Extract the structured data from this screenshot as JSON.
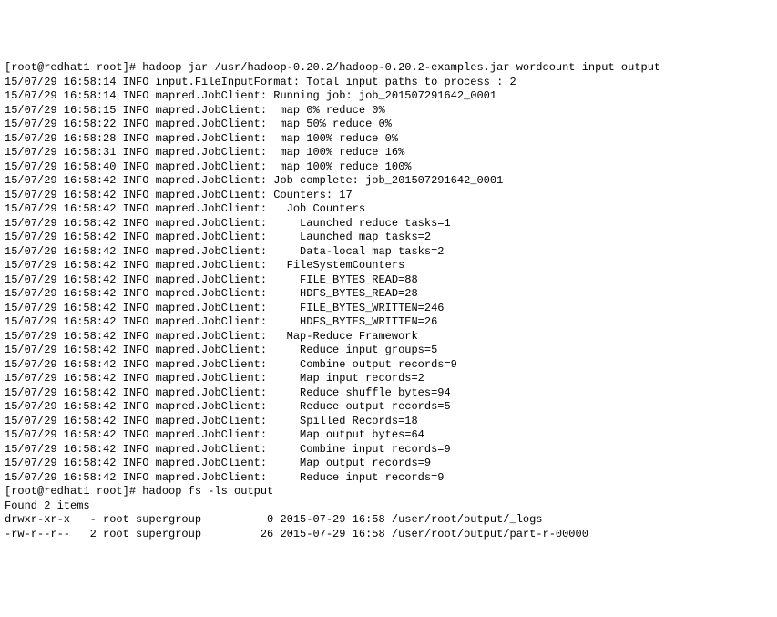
{
  "terminal": {
    "prompt1": "[root@redhat1 root]# hadoop jar /usr/hadoop-0.20.2/hadoop-0.20.2-examples.jar wordcount input output",
    "lines": [
      "15/07/29 16:58:14 INFO input.FileInputFormat: Total input paths to process : 2",
      "15/07/29 16:58:14 INFO mapred.JobClient: Running job: job_201507291642_0001",
      "15/07/29 16:58:15 INFO mapred.JobClient:  map 0% reduce 0%",
      "15/07/29 16:58:22 INFO mapred.JobClient:  map 50% reduce 0%",
      "15/07/29 16:58:28 INFO mapred.JobClient:  map 100% reduce 0%",
      "15/07/29 16:58:31 INFO mapred.JobClient:  map 100% reduce 16%",
      "15/07/29 16:58:40 INFO mapred.JobClient:  map 100% reduce 100%",
      "15/07/29 16:58:42 INFO mapred.JobClient: Job complete: job_201507291642_0001",
      "15/07/29 16:58:42 INFO mapred.JobClient: Counters: 17",
      "15/07/29 16:58:42 INFO mapred.JobClient:   Job Counters ",
      "15/07/29 16:58:42 INFO mapred.JobClient:     Launched reduce tasks=1",
      "15/07/29 16:58:42 INFO mapred.JobClient:     Launched map tasks=2",
      "15/07/29 16:58:42 INFO mapred.JobClient:     Data-local map tasks=2",
      "15/07/29 16:58:42 INFO mapred.JobClient:   FileSystemCounters",
      "15/07/29 16:58:42 INFO mapred.JobClient:     FILE_BYTES_READ=88",
      "15/07/29 16:58:42 INFO mapred.JobClient:     HDFS_BYTES_READ=28",
      "15/07/29 16:58:42 INFO mapred.JobClient:     FILE_BYTES_WRITTEN=246",
      "15/07/29 16:58:42 INFO mapred.JobClient:     HDFS_BYTES_WRITTEN=26",
      "15/07/29 16:58:42 INFO mapred.JobClient:   Map-Reduce Framework",
      "15/07/29 16:58:42 INFO mapred.JobClient:     Reduce input groups=5",
      "15/07/29 16:58:42 INFO mapred.JobClient:     Combine output records=9",
      "15/07/29 16:58:42 INFO mapred.JobClient:     Map input records=2",
      "15/07/29 16:58:42 INFO mapred.JobClient:     Reduce shuffle bytes=94",
      "15/07/29 16:58:42 INFO mapred.JobClient:     Reduce output records=5",
      "15/07/29 16:58:42 INFO mapred.JobClient:     Spilled Records=18",
      "15/07/29 16:58:42 INFO mapred.JobClient:     Map output bytes=64",
      "15/07/29 16:58:42 INFO mapred.JobClient:     Combine input records=9",
      "15/07/29 16:58:42 INFO mapred.JobClient:     Map output records=9",
      "15/07/29 16:58:42 INFO mapred.JobClient:     Reduce input records=9"
    ],
    "prompt2": "[root@redhat1 root]# hadoop fs -ls output",
    "found": "Found 2 items",
    "ls1": "drwxr-xr-x   - root supergroup          0 2015-07-29 16:58 /user/root/output/_logs",
    "ls2": "-rw-r--r--   2 root supergroup         26 2015-07-29 16:58 /user/root/output/part-r-00000"
  }
}
